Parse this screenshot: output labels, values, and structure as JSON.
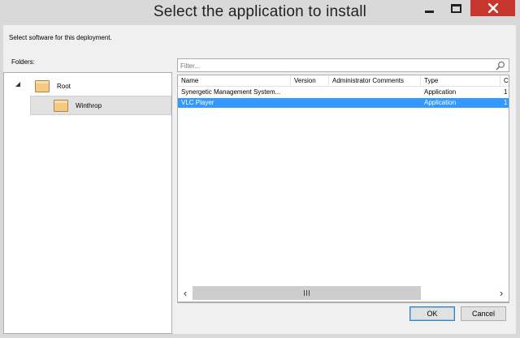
{
  "window": {
    "title": "Select the application to install",
    "controls": {
      "minimize": "minimize-icon",
      "maximize": "maximize-icon",
      "close": "close-icon"
    }
  },
  "dialog": {
    "subtitle": "Select software for this deployment.",
    "folders_label": "Folders:"
  },
  "tree": {
    "items": [
      {
        "label": "Root",
        "icon": "folder-icon",
        "expanded": true
      },
      {
        "label": "Winthrop",
        "icon": "folder-icon",
        "selected": true
      }
    ]
  },
  "filter": {
    "placeholder": "Filter...",
    "value": "",
    "icon": "search-icon"
  },
  "table": {
    "columns": [
      "Name",
      "Version",
      "Administrator Comments",
      "Type",
      "C"
    ],
    "rows": [
      {
        "name": "Synergetic Management System...",
        "version": "",
        "comments": "",
        "type": "Application",
        "extra": "1",
        "selected": false
      },
      {
        "name": "VLC Player",
        "version": "",
        "comments": "",
        "type": "Application",
        "extra": "1",
        "selected": true
      }
    ]
  },
  "buttons": {
    "ok": "OK",
    "cancel": "Cancel"
  },
  "colors": {
    "selection": "#3399ff",
    "close_button": "#c7372e",
    "folder": "#f6c982"
  }
}
